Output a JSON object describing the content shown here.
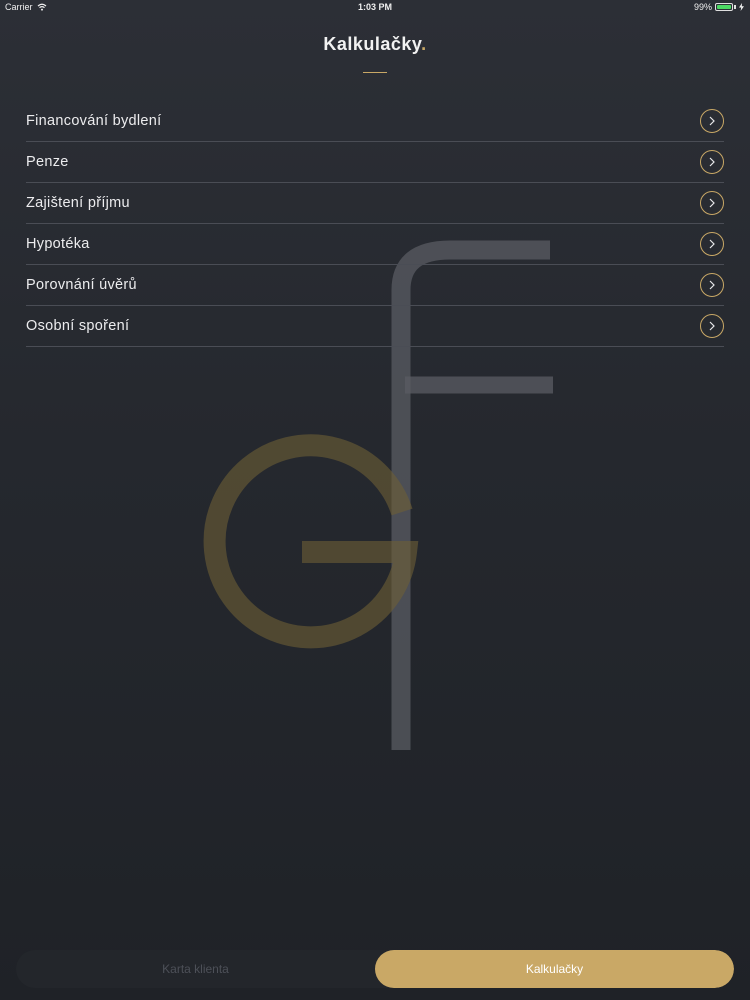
{
  "status_bar": {
    "carrier": "Carrier",
    "time": "1:03 PM",
    "battery_percent": "99%"
  },
  "header": {
    "title": "Kalkulačky",
    "title_dot": "."
  },
  "menu": {
    "items": [
      {
        "label": "Financování bydlení",
        "icon": "chevron-right-icon"
      },
      {
        "label": "Penze",
        "icon": "chevron-right-icon"
      },
      {
        "label": "Zajištení příjmu",
        "icon": "chevron-right-icon"
      },
      {
        "label": "Hypotéka",
        "icon": "chevron-right-icon"
      },
      {
        "label": "Porovnání úvěrů",
        "icon": "chevron-right-icon"
      },
      {
        "label": "Osobní spoření",
        "icon": "chevron-right-icon"
      }
    ]
  },
  "tabs": {
    "items": [
      {
        "label": "Karta klienta",
        "active": false
      },
      {
        "label": "Kalkulačky",
        "active": true
      }
    ]
  },
  "colors": {
    "accent": "#c9a866",
    "background": "#2a2d33"
  },
  "watermark": {
    "icon": "gf-logo-watermark"
  }
}
